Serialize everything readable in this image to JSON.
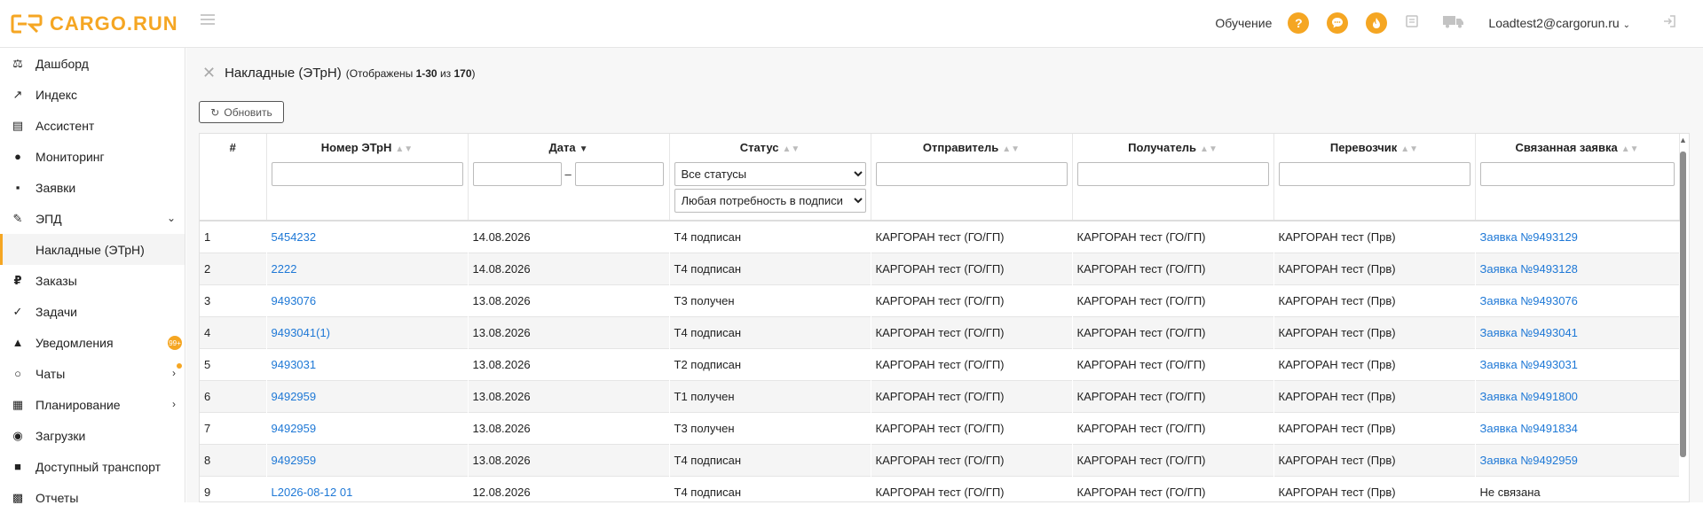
{
  "brand": {
    "name": "CARGO.RUN",
    "accent": "#f5a623"
  },
  "header": {
    "learn_label": "Обучение",
    "help_icon": "?",
    "icons": [
      "help-icon",
      "chat-icon",
      "fire-icon",
      "document-icon",
      "truck-icon"
    ],
    "user": "Loadtest2@cargorun.ru",
    "logout_icon": "logout-icon"
  },
  "sidebar": {
    "items": [
      {
        "label": "Дашборд",
        "icon": "dashboard-icon"
      },
      {
        "label": "Индекс",
        "icon": "index-icon"
      },
      {
        "label": "Ассистент",
        "icon": "assistant-icon"
      },
      {
        "label": "Мониторинг",
        "icon": "monitoring-icon"
      },
      {
        "label": "Заявки",
        "icon": "requests-icon"
      },
      {
        "label": "ЭПД",
        "icon": "epd-icon"
      },
      {
        "label": "Накладные (ЭТрН)",
        "icon": ""
      },
      {
        "label": "Заказы",
        "icon": "ruble-icon"
      },
      {
        "label": "Задачи",
        "icon": "check-icon"
      },
      {
        "label": "Уведомления",
        "icon": "bell-icon"
      },
      {
        "label": "Чаты",
        "icon": "chat-icon"
      },
      {
        "label": "Планирование",
        "icon": "calendar-icon"
      },
      {
        "label": "Загрузки",
        "icon": "compass-icon"
      },
      {
        "label": "Доступный транспорт",
        "icon": "truck-icon"
      },
      {
        "label": "Отчеты",
        "icon": "report-icon"
      }
    ],
    "notifications_badge": "99+"
  },
  "page": {
    "title": "Накладные (ЭТрН)",
    "shown_prefix": "(Отображены ",
    "shown_range": "1-30",
    "shown_of": " из ",
    "shown_total": "170",
    "shown_suffix": ")",
    "refresh_label": "Обновить"
  },
  "table": {
    "columns": [
      "#",
      "Номер ЭТрН",
      "Дата",
      "Статус",
      "Отправитель",
      "Получатель",
      "Перевозчик",
      "Связанная заявка"
    ],
    "filters": {
      "status_selected": "Все статусы",
      "signature_selected": "Любая потребность в подписи",
      "date_separator": "–"
    },
    "rows": [
      {
        "n": "1",
        "number": "5454232",
        "date": "14.08.2026",
        "status": "Т4 подписан",
        "sender": "КАРГОРАН тест (ГО/ГП)",
        "receiver": "КАРГОРАН тест (ГО/ГП)",
        "carrier": "КАРГОРАН тест (Прв)",
        "request": "Заявка №9493129"
      },
      {
        "n": "2",
        "number": "2222",
        "date": "14.08.2026",
        "status": "Т4 подписан",
        "sender": "КАРГОРАН тест (ГО/ГП)",
        "receiver": "КАРГОРАН тест (ГО/ГП)",
        "carrier": "КАРГОРАН тест (Прв)",
        "request": "Заявка №9493128"
      },
      {
        "n": "3",
        "number": "9493076",
        "date": "13.08.2026",
        "status": "Т3 получен",
        "sender": "КАРГОРАН тест (ГО/ГП)",
        "receiver": "КАРГОРАН тест (ГО/ГП)",
        "carrier": "КАРГОРАН тест (Прв)",
        "request": "Заявка №9493076"
      },
      {
        "n": "4",
        "number": "9493041(1)",
        "date": "13.08.2026",
        "status": "Т4 подписан",
        "sender": "КАРГОРАН тест (ГО/ГП)",
        "receiver": "КАРГОРАН тест (ГО/ГП)",
        "carrier": "КАРГОРАН тест (Прв)",
        "request": "Заявка №9493041"
      },
      {
        "n": "5",
        "number": "9493031",
        "date": "13.08.2026",
        "status": "Т2 подписан",
        "sender": "КАРГОРАН тест (ГО/ГП)",
        "receiver": "КАРГОРАН тест (ГО/ГП)",
        "carrier": "КАРГОРАН тест (Прв)",
        "request": "Заявка №9493031"
      },
      {
        "n": "6",
        "number": "9492959",
        "date": "13.08.2026",
        "status": "Т1 получен",
        "sender": "КАРГОРАН тест (ГО/ГП)",
        "receiver": "КАРГОРАН тест (ГО/ГП)",
        "carrier": "КАРГОРАН тест (Прв)",
        "request": "Заявка №9491800"
      },
      {
        "n": "7",
        "number": "9492959",
        "date": "13.08.2026",
        "status": "Т3 получен",
        "sender": "КАРГОРАН тест (ГО/ГП)",
        "receiver": "КАРГОРАН тест (ГО/ГП)",
        "carrier": "КАРГОРАН тест (Прв)",
        "request": "Заявка №9491834"
      },
      {
        "n": "8",
        "number": "9492959",
        "date": "13.08.2026",
        "status": "Т4 подписан",
        "sender": "КАРГОРАН тест (ГО/ГП)",
        "receiver": "КАРГОРАН тест (ГО/ГП)",
        "carrier": "КАРГОРАН тест (Прв)",
        "request": "Заявка №9492959"
      },
      {
        "n": "9",
        "number": "L2026-08-12 01",
        "date": "12.08.2026",
        "status": "Т4 подписан",
        "sender": "КАРГОРАН тест (ГО/ГП)",
        "receiver": "КАРГОРАН тест (ГО/ГП)",
        "carrier": "КАРГОРАН тест (Прв)",
        "request": "Не связана"
      }
    ]
  }
}
